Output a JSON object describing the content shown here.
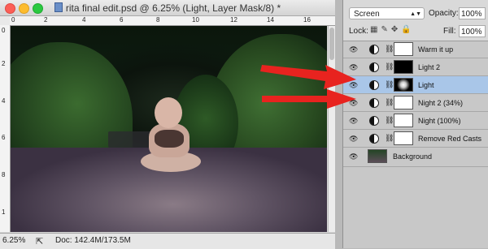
{
  "window": {
    "title": "rita final edit.psd @ 6.25% (Light, Layer Mask/8) *"
  },
  "rulers": {
    "top_ticks": [
      "0",
      "2",
      "4",
      "6",
      "8",
      "10",
      "12",
      "14",
      "16"
    ],
    "left_ticks": [
      "0",
      "2",
      "4",
      "6",
      "8",
      "1"
    ]
  },
  "statusbar": {
    "zoom": "6.25%",
    "doc_info": "Doc: 142.4M/173.5M"
  },
  "layers_panel": {
    "blend_mode": "Screen",
    "opacity_label": "Opacity:",
    "opacity": "100%",
    "lock_label": "Lock:",
    "fill_label": "Fill:",
    "fill": "100%",
    "layers": [
      {
        "name": "Warm it up",
        "mask": "white",
        "selected": false
      },
      {
        "name": "Light 2",
        "mask": "black",
        "selected": false
      },
      {
        "name": "Light",
        "mask": "glow",
        "selected": true
      },
      {
        "name": "Night 2 (34%)",
        "mask": "white",
        "selected": false
      },
      {
        "name": "Night (100%)",
        "mask": "white",
        "selected": false
      },
      {
        "name": "Remove Red Casts",
        "mask": "white",
        "selected": false
      }
    ],
    "background_layer": {
      "name": "Background"
    }
  },
  "colors": {
    "selection": "#a9c6e8",
    "arrow": "#e8231f"
  }
}
